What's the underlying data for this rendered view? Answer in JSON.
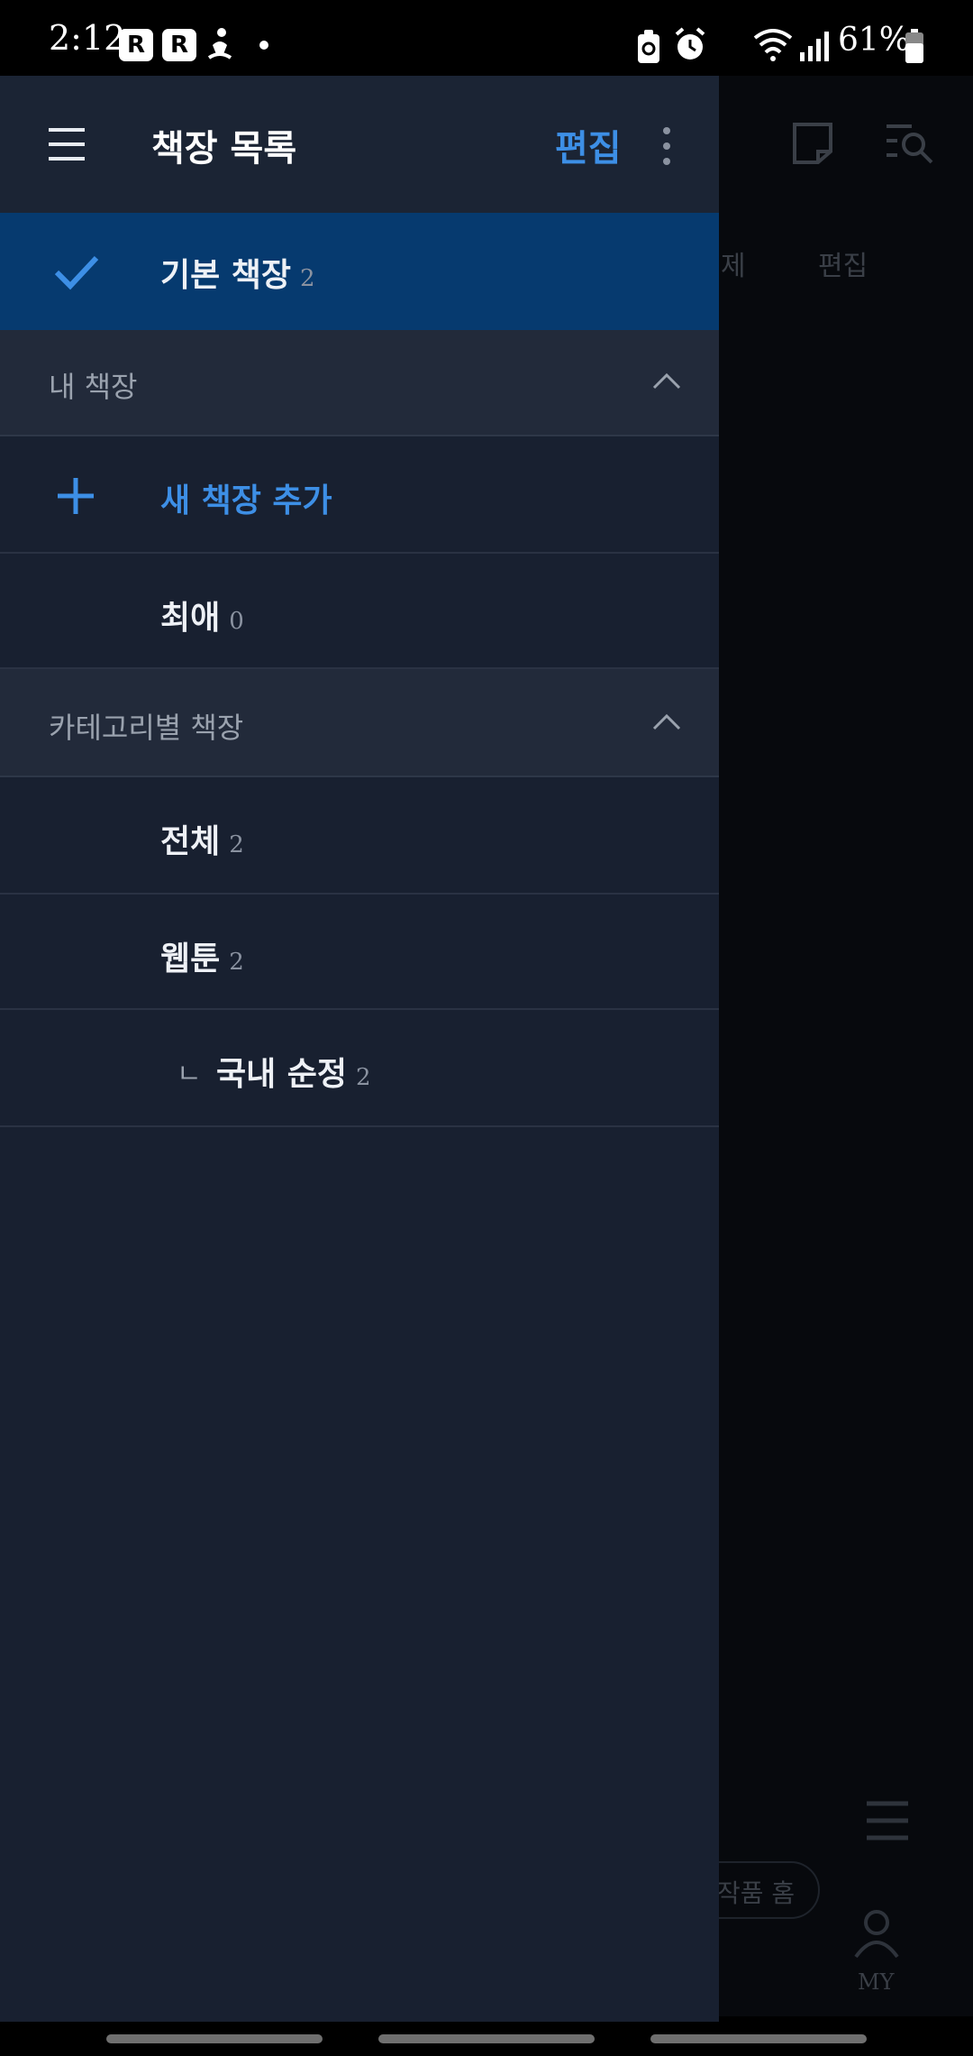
{
  "status_bar": {
    "time": "2:12",
    "app_badge_1": "R",
    "app_badge_2": "R",
    "battery_percent": "61%"
  },
  "background_app": {
    "filter_label": "제",
    "edit_label": "편집",
    "chip_label": "작품 홈",
    "my_tab_label": "MY"
  },
  "drawer": {
    "title": "책장 목록",
    "edit_label": "편집",
    "selected_shelf": {
      "label": "기본 책장",
      "count": "2"
    },
    "sections": [
      {
        "label": "내 책장",
        "add_label": "새 책장 추가",
        "items": [
          {
            "label": "최애",
            "count": "0"
          }
        ]
      },
      {
        "label": "카테고리별 책장",
        "items": [
          {
            "label": "전체",
            "count": "2"
          },
          {
            "label": "웹툰",
            "count": "2"
          },
          {
            "prefix": "ㄴ",
            "label": "국내 순정",
            "count": "2"
          }
        ]
      }
    ]
  },
  "colors": {
    "accent": "#3d8fe6",
    "drawer_bg": "#182030",
    "selected_bg": "#063a6f",
    "section_bg": "#222a3a"
  }
}
